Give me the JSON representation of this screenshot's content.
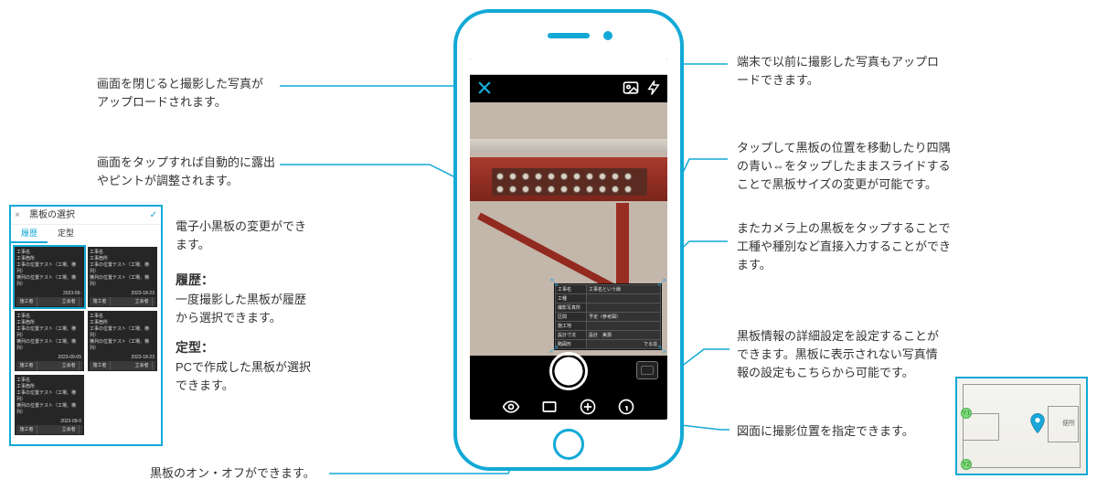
{
  "callouts": {
    "close": "画面を閉じると撮影した写真が\nアップロードされます。",
    "tapfocus": "画面をタップすれば自動的に露出\nやピントが調整されます。",
    "boardchange": "電子小黒板の変更ができ\nます。",
    "history_h": "履歴：",
    "history_b": "一度撮影した黒板が履歴\nから選択できます。",
    "template_h": "定型：",
    "template_b": "PCで作成した黒板が選択\nできます。",
    "boardtoggle": "黒板のオン・オフができます。",
    "gallery": "端末で以前に撮影した写真もアップロ\nードできます。",
    "move": "タップして黒板の位置を移動したり四隅\nの青い⇔をタップしたままスライドする\nことで黒板サイズの変更が可能です。",
    "editboard": "またカメラ上の黒板をタップすることで\n工種や種別など直接入力することができ\nます。",
    "detail": "黒板情報の詳細設定を設定することが\nできます。黒板に表示されない写真情\n報の設定もこちらから可能です。",
    "mappos": "図面に撮影位置を指定できます。"
  },
  "panel": {
    "title": "黒板の選択",
    "tab_history": "履歴",
    "tab_template": "定型",
    "card_labels": {
      "r1": "工事名",
      "r2": "工事箇所",
      "r3a": "工事の位置テスト（工場、横列）\n横列の位置テスト（工場、横列）",
      "f1": "施工者",
      "f2": "",
      "f3": "立会者"
    },
    "dates": [
      "2023-09-",
      "2023-18-23",
      "2023-09-05",
      "2023-18-23",
      "2023-09-0",
      ""
    ]
  },
  "blackboard": {
    "rows": [
      [
        "工事名",
        "工事名という線"
      ],
      [
        "工種",
        ""
      ],
      [
        "撮影写真所",
        ""
      ],
      [
        "区間",
        "予定（参考図）"
      ],
      [
        "施工地",
        ""
      ],
      [
        "設計寸法",
        "設計　実測　"
      ],
      [
        "略図形",
        ""
      ]
    ],
    "slogan": "でる造"
  },
  "map": {
    "nodes": [
      "Y1",
      "Y2"
    ],
    "room": "便所"
  }
}
